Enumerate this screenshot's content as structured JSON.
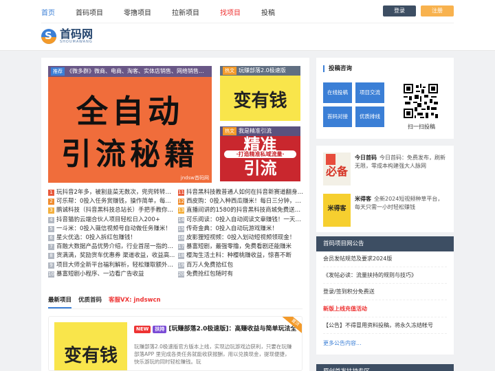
{
  "nav": {
    "items": [
      "首页",
      "首码项目",
      "零撸项目",
      "拉新项目",
      "找项目",
      "投稿"
    ],
    "login": "登录",
    "register": "注册"
  },
  "logo": {
    "name": "首码网",
    "sub": "SHOUMAWANG"
  },
  "hero": {
    "badge": "推荐",
    "caption": "《微多群》微商、电商、淘客、实体店销售、网络销售...",
    "line1": "全自动",
    "line2": "引流秘籍",
    "watermark": "jndsw首码网"
  },
  "thumbs": [
    {
      "badge": "热文",
      "caption": "玩赚部落2.0极速版",
      "text": "变有钱"
    },
    {
      "badge": "热文",
      "caption": "我是精准引流",
      "text1": "精准",
      "sub": "·打造精准私域流量·",
      "text2": "引流"
    }
  ],
  "list_left": [
    "玩抖音2年多，被割韭菜无数次，兜兜转转来...",
    "可乐帮：0投入任务赏赚钱，操作简单，每...",
    "鹏诚科技（抖音黑科技总站长）手把手教你如...",
    "抖音猫豹云端合伙人项目轻松日入200+",
    "一斗米：0投入薇信视频号自动做任务赚米！",
    "星火优选：0投入拆红包赚钱！",
    "百融大数据产品优势介绍，行业首屈一指的大...",
    "货满满，奖励货车优惠券 渠道收益，收益高...",
    "项目大师全新平台福利解析，轻松赚取额外收...",
    "暴富短剧小程序、一边看广告收益"
  ],
  "list_right": [
    "抖音黑科技教普通人如何在抖音新赛道翻身，...",
    "西皮购：0投入种西瓜赚米！每日三分钟，每...",
    "直播间讲的1580的抖音黑科技商城免费送，...",
    "可乐阅读：0投入自动阅读文章赚钱！一天可...",
    "传奇金典：0投入自动玩游戏赚米！",
    "皮影狸短视频：0投入划动短视频领现金！",
    "暴富短剧，最强零撸，免费看剧还能赚米",
    "樱淘生活土科：种樱桃赚收益，惊喜不断",
    "百万人免费拾红包",
    "免费抢红包随时有"
  ],
  "tabs": [
    "最新项目",
    "优质首码",
    "客服VX: jndswcn"
  ],
  "card": {
    "badge_new": "NEW",
    "badge_cat": "扶持",
    "title": "[玩赚部落2.0极速版]：高赚收益与简单玩法全解析",
    "desc": "玩赚部落2.0极速版官方版本上线，实现边玩游戏边获利，只要在玩赚部落APP 里完成各类任务就能收获报酬，用以兑换现金，提现便捷，快乐游玩的同时轻松赚钱。玩",
    "img_text": "变有钱",
    "ribbon": "置顶"
  },
  "submit_panel": {
    "title": "投稿咨询",
    "buttons": [
      "在线投稿",
      "项目交流",
      "首码对接",
      "优质排线"
    ],
    "qr_caption": "扫一扫投稿"
  },
  "entries": [
    {
      "name": "今日首码",
      "desc": "今日首码：免费发布，刷新无限，零成本构建强大人脉网",
      "img_text": "必备"
    },
    {
      "name": "米得客",
      "desc": "全新2024短视频种草平台，每天只需一小时轻松赚钱",
      "img_text": "米得客"
    }
  ],
  "announce": {
    "title": "首码项目网公告",
    "items": [
      "会员发帖规范及要求2024版",
      "《发帖必读：流量扶持的规则与技巧》",
      "登录/签到积分免费送",
      "新版上线充值活动",
      "【公告】不得冒用资料投稿，将永久冻结帐号"
    ],
    "more": "更多公告内容..."
  },
  "next_panel": {
    "title": "原创首发扶持专区"
  },
  "colors": {
    "accent": "#3b7fd6",
    "header_dark": "#3d4e63",
    "register": "#f8b24e",
    "hot": "#e33333"
  }
}
